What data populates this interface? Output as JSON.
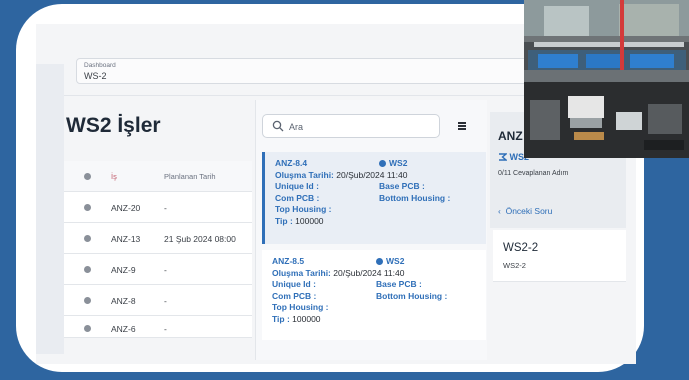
{
  "breadcrumb": {
    "top": "Dashboard",
    "current": "WS-2"
  },
  "page_title": "WS2 İşler",
  "table": {
    "columns": [
      "İş",
      "Planlanan Tarih"
    ],
    "rows": [
      {
        "is": "ANZ-20",
        "date": "-"
      },
      {
        "is": "ANZ-13",
        "date": "21 Şub 2024 08:00"
      },
      {
        "is": "ANZ-9",
        "date": "-"
      },
      {
        "is": "ANZ-8",
        "date": "-"
      },
      {
        "is": "ANZ-6",
        "date": "-"
      }
    ]
  },
  "search": {
    "placeholder": "Ara"
  },
  "jobs": [
    {
      "code": "ANZ-8.4",
      "ws": "WS2",
      "created_label": "Oluşma Tarihi:",
      "created_value": "20/Şub/2024 11:40",
      "unique_id_label": "Unique Id :",
      "base_pcb_label": "Base PCB :",
      "com_pcb_label": "Com PCB :",
      "bottom_housing_label": "Bottom Housing :",
      "top_housing_label": "Top Housing :",
      "tip_label": "Tip :",
      "tip_value": "100000"
    },
    {
      "code": "ANZ-8.5",
      "ws": "WS2",
      "created_label": "Oluşma Tarihi:",
      "created_value": "20/Şub/2024 11:40",
      "unique_id_label": "Unique Id :",
      "base_pcb_label": "Base PCB :",
      "com_pcb_label": "Com PCB :",
      "bottom_housing_label": "Bottom Housing :",
      "top_housing_label": "Top Housing :",
      "tip_label": "Tip :",
      "tip_value": "100000"
    }
  ],
  "right_panel": {
    "title": "ANZ",
    "ws": "WS2",
    "progress": "0/11 Cevaplanan Adım",
    "back": "Önceki Soru",
    "step_title": "WS2-2",
    "step_sub": "WS2-2"
  },
  "colors": {
    "accent": "#2f6fb8",
    "frame": "#2e65a0"
  }
}
